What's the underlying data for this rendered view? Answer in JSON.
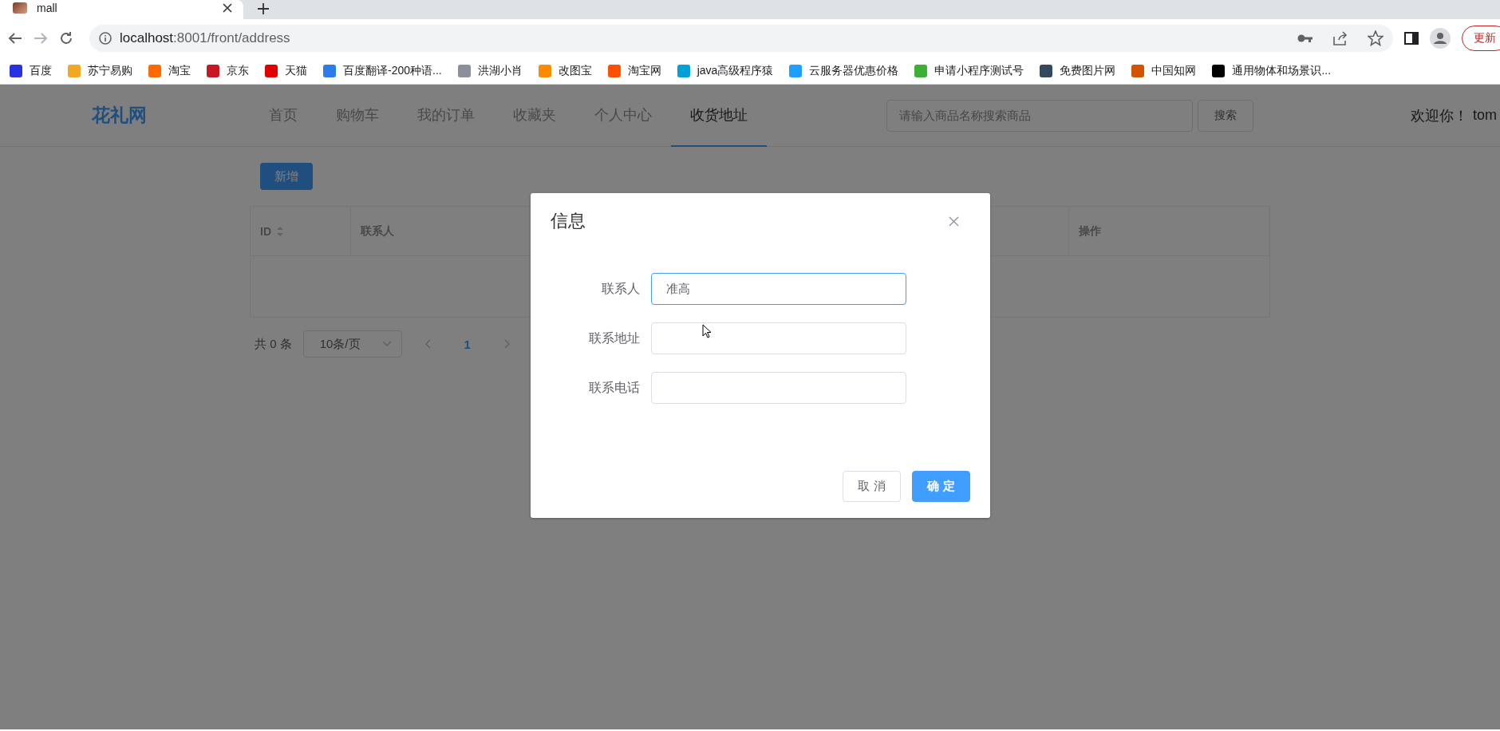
{
  "browser": {
    "tab": {
      "title": "mall"
    },
    "url": {
      "host": "localhost",
      "path": ":8001/front/address"
    },
    "update_button": "更新",
    "bookmarks": [
      {
        "label": "百度",
        "color": "#2932e1"
      },
      {
        "label": "苏宁易购",
        "color": "#f5a623"
      },
      {
        "label": "淘宝",
        "color": "#ff6a00"
      },
      {
        "label": "京东",
        "color": "#c81623"
      },
      {
        "label": "天猫",
        "color": "#e00000"
      },
      {
        "label": "百度翻译-200种语...",
        "color": "#2b7de9"
      },
      {
        "label": "洪湖小肖",
        "color": "#8a8f99"
      },
      {
        "label": "改图宝",
        "color": "#ff8a00"
      },
      {
        "label": "淘宝网",
        "color": "#ff5000"
      },
      {
        "label": "java高级程序猿",
        "color": "#00a1d6"
      },
      {
        "label": "云服务器优惠价格",
        "color": "#1e9fff"
      },
      {
        "label": "申请小程序测试号",
        "color": "#3cb034"
      },
      {
        "label": "免费图片网",
        "color": "#34495e"
      },
      {
        "label": "中国知网",
        "color": "#d35400"
      },
      {
        "label": "通用物体和场景识...",
        "color": "#000000"
      }
    ]
  },
  "header": {
    "logo": "花礼网",
    "nav": [
      {
        "label": "首页",
        "selected": false
      },
      {
        "label": "购物车",
        "selected": false
      },
      {
        "label": "我的订单",
        "selected": false
      },
      {
        "label": "收藏夹",
        "selected": false
      },
      {
        "label": "个人中心",
        "selected": false
      },
      {
        "label": "收货地址",
        "selected": true
      }
    ],
    "search": {
      "placeholder": "请输入商品名称搜索商品",
      "button": "搜索"
    },
    "welcome": "欢迎你！",
    "user": "tom"
  },
  "toolbar": {
    "add_button": "新增"
  },
  "table": {
    "columns": [
      {
        "label": "ID",
        "sortable": true
      },
      {
        "label": "联系人",
        "sortable": false
      },
      {
        "label": "操作",
        "sortable": false
      }
    ]
  },
  "pagination": {
    "total": "共 0 条",
    "page_size": "10条/页",
    "pages": [
      {
        "label": "1",
        "selected": true
      }
    ]
  },
  "dialog": {
    "title": "信息",
    "fields": [
      {
        "label": "联系人",
        "value": "准高",
        "focused": true
      },
      {
        "label": "联系地址",
        "focused": false
      },
      {
        "label": "联系电话",
        "focused": false
      }
    ],
    "cancel_button": "取 消",
    "confirm_button": "确 定"
  }
}
